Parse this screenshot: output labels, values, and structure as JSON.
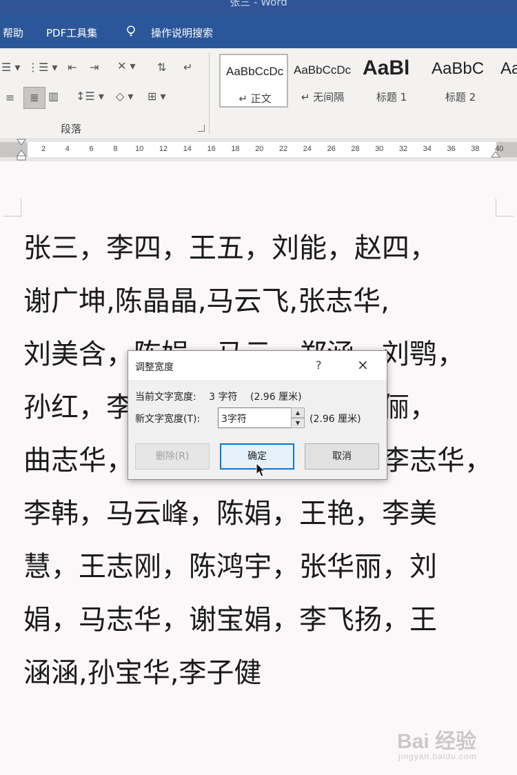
{
  "window": {
    "title": "张三 - Word"
  },
  "menu": {
    "help": "帮助",
    "pdf_tools": "PDF工具集",
    "tell_me": "操作说明搜索"
  },
  "ribbon": {
    "paragraph_group_label": "段落",
    "styles": [
      {
        "sample": "AaBbCcDc",
        "name": "↵ 正文"
      },
      {
        "sample": "AaBbCcDc",
        "name": "↵ 无间隔"
      },
      {
        "sample": "AaBl",
        "name": "标题 1"
      },
      {
        "sample": "AaBbC",
        "name": "标题 2"
      },
      {
        "sample": "Aa"
      }
    ]
  },
  "ruler": {
    "ticks": [
      "2",
      "4",
      "6",
      "8",
      "10",
      "12",
      "14",
      "16",
      "18",
      "20",
      "22",
      "24",
      "26",
      "28",
      "30",
      "32",
      "34",
      "36",
      "38",
      "40"
    ]
  },
  "document": {
    "lines": [
      "张三，李四，王五，刘能，赵四，",
      "谢广坤,陈晶晶,马云飞,张志华,",
      "刘美含，陈娟，马云，郑涵，刘鹗，",
      "孙红，李华，王丽，张志，孙俪，",
      "曲志华，刘美，赵华，王华，李志华，",
      "李韩，马云峰，陈娟，王艳，李美",
      "慧，王志刚，陈鸿宇，张华丽，刘",
      "娟，马志华，谢宝娟，李飞扬，王",
      "涵涵,孙宝华,李子健"
    ]
  },
  "dialog": {
    "title": "调整宽度",
    "help": "?",
    "close": "×",
    "current_width_label": "当前文字宽度:",
    "current_width_value": "3 字符",
    "current_width_cm": "(2.96 厘米)",
    "new_width_label": "新文字宽度(T):",
    "new_width_value": "3字符",
    "new_width_cm": "(2.96 厘米)",
    "delete_button": "删除(R)",
    "ok_button": "确定",
    "cancel_button": "取消"
  },
  "watermark": {
    "brand": "Bai 经验",
    "url": "jingyan.baidu.com"
  }
}
